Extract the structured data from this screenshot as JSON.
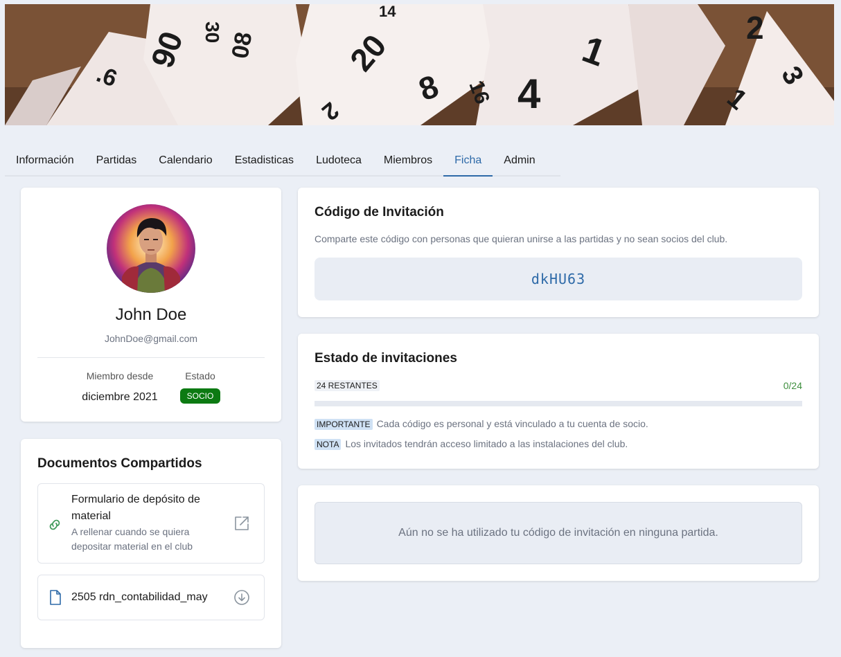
{
  "tabs": [
    {
      "label": "Información"
    },
    {
      "label": "Partidas"
    },
    {
      "label": "Calendario"
    },
    {
      "label": "Estadisticas"
    },
    {
      "label": "Ludoteca"
    },
    {
      "label": "Miembros"
    },
    {
      "label": "Ficha",
      "active": true
    },
    {
      "label": "Admin"
    }
  ],
  "profile": {
    "name": "John Doe",
    "email": "JohnDoe@gmail.com",
    "member_since_label": "Miembro desde",
    "member_since_value": "diciembre 2021",
    "status_label": "Estado",
    "status_value": "SOCIO"
  },
  "documents": {
    "title": "Documentos Compartidos",
    "items": [
      {
        "title": "Formulario de depósito de material",
        "subtitle": "A rellenar cuando se quiera depositar material en el club",
        "icon": "link-icon",
        "action_icon": "external-link-icon"
      },
      {
        "title": "2505 rdn_contabilidad_may",
        "icon": "file-icon",
        "action_icon": "download-icon"
      }
    ]
  },
  "invite_code": {
    "title": "Código de Invitación",
    "description": "Comparte este código con personas que quieran unirse a las partidas y no sean socios del club.",
    "code": "dkHU63"
  },
  "invite_status": {
    "title": "Estado de invitaciones",
    "remaining_label": "24 RESTANTES",
    "count": "0/24",
    "progress": 0,
    "notes": [
      {
        "tag": "IMPORTANTE",
        "text": "Cada código es personal y está vinculado a tu cuenta de socio."
      },
      {
        "tag": "NOTA",
        "text": "Los invitados tendrán acceso limitado a las instalaciones del club."
      }
    ]
  },
  "usage": {
    "empty_text": "Aún no se ha utilizado tu código de invitación en ninguna partida."
  },
  "colors": {
    "accent": "#2e6aa8",
    "socio_badge": "#0c7a12",
    "count_green": "#3f8f3f",
    "page_bg": "#ebeff6"
  }
}
